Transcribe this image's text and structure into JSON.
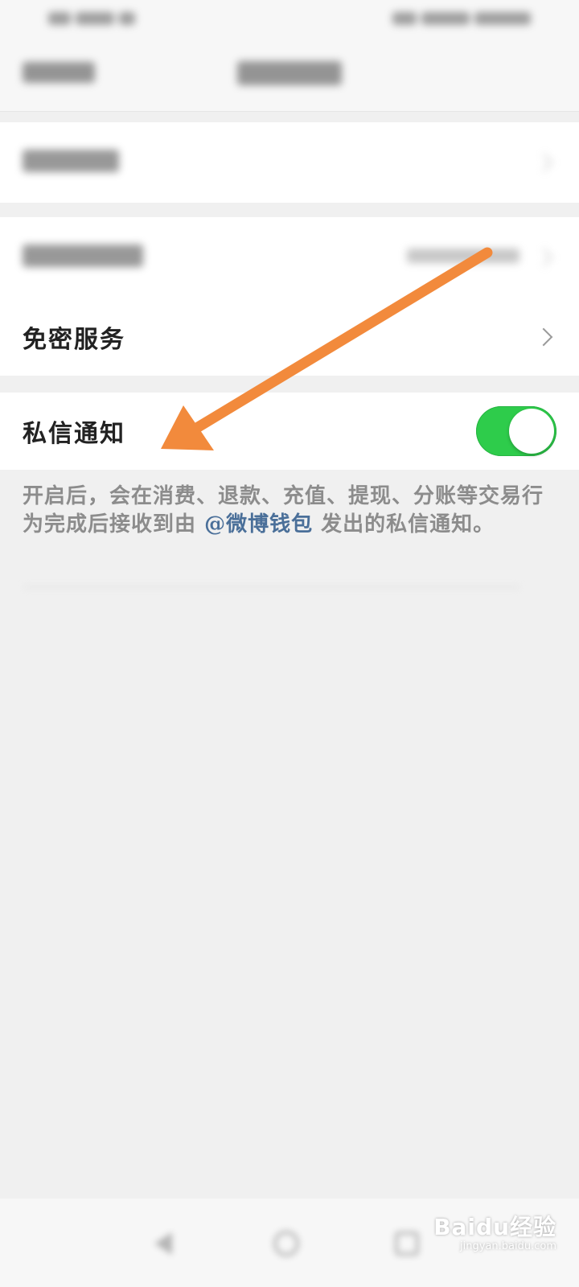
{
  "status_bar": {
    "left_text": "",
    "right_text": ""
  },
  "nav": {
    "back_label": "",
    "title": ""
  },
  "sections": {
    "transaction_record": {
      "label": ""
    },
    "bound_account": {
      "label": "",
      "value": ""
    },
    "password_free": {
      "label": "免密服务"
    },
    "message_notify": {
      "label": "私信通知",
      "enabled": true
    }
  },
  "hint": {
    "before_link": "开启后，会在消费、退款、充值、提现、分账等交易行为完成后接收到由",
    "link": "@微博钱包",
    "after_link": " 发出的私信通知。"
  },
  "watermark": {
    "main": "Baidu经验",
    "sub": "jingyan.baidu.com"
  },
  "colors": {
    "toggle_on": "#2ecc4b",
    "link": "#4a6f99",
    "annotation_arrow": "#f28a3c",
    "background": "#f0f0f0"
  },
  "icons": [
    "chevron-right-icon",
    "back-nav-icon",
    "home-nav-icon",
    "recent-apps-icon",
    "annotation-arrow-icon"
  ]
}
